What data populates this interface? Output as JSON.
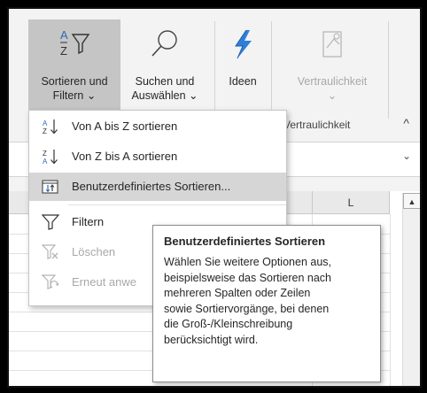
{
  "ribbon": {
    "sort_filter": {
      "line1": "Sortieren und",
      "line2": "Filtern ⌄"
    },
    "find_select": {
      "line1": "Suchen und",
      "line2": "Auswählen ⌄"
    },
    "ideas": {
      "label": "Ideen"
    },
    "sensitivity": {
      "label": "Vertraulichkeit",
      "caret": "⌄",
      "group": "Vertraulichkeit"
    },
    "collapse": "^"
  },
  "formula_bar": {
    "chevron": "⌄"
  },
  "sheet": {
    "column_label": "L",
    "scroll_up": "▲"
  },
  "menu": {
    "items": [
      {
        "label": "Von A bis Z sortieren",
        "icon": "sort-az-icon",
        "disabled": false,
        "highlighted": false
      },
      {
        "label": "Von Z bis A sortieren",
        "icon": "sort-za-icon",
        "disabled": false,
        "highlighted": false
      },
      {
        "label": "Benutzerdefiniertes Sortieren...",
        "icon": "custom-sort-icon",
        "disabled": false,
        "highlighted": true
      },
      {
        "label": "Filtern",
        "icon": "filter-icon",
        "disabled": false,
        "highlighted": false
      },
      {
        "label": "Löschen",
        "icon": "clear-filter-icon",
        "disabled": true,
        "highlighted": false
      },
      {
        "label": "Erneut anwe",
        "icon": "reapply-icon",
        "disabled": true,
        "highlighted": false
      }
    ]
  },
  "tooltip": {
    "title": "Benutzerdefiniertes Sortieren",
    "lines": [
      "Wählen Sie weitere Optionen aus,",
      "beispielsweise das Sortieren nach",
      "mehreren Spalten oder Zeilen",
      "sowie Sortiervorgänge, bei denen",
      "die Groß-/Kleinschreibung",
      "berücksichtigt wird."
    ]
  },
  "colors": {
    "accent_blue": "#2b6cb7",
    "lightning": "#2f7fd8",
    "highlight": "#d6d6d6"
  }
}
